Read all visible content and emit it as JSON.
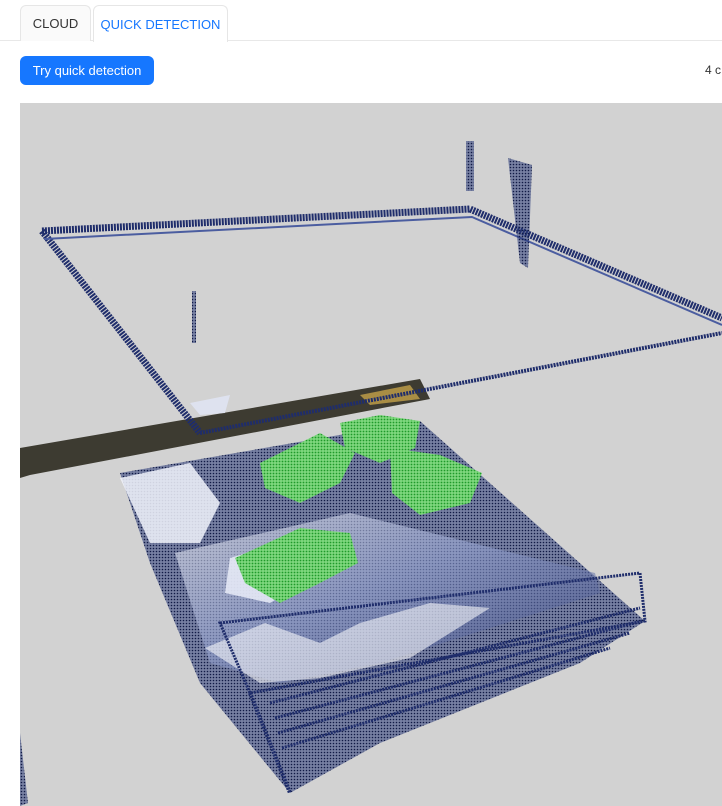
{
  "tabs": {
    "cloud_label": "CLOUD",
    "quick_detection_label": "QUICK DETECTION",
    "active": "quick_detection"
  },
  "toolbar": {
    "try_quick_detection_label": "Try quick detection",
    "count_text": "4 c"
  },
  "viewer": {
    "background_color": "#d2d2d2",
    "cloud_color": "#1f2d6b",
    "detection_color": "#3dbb3d"
  },
  "colors": {
    "accent": "#1677ff"
  }
}
